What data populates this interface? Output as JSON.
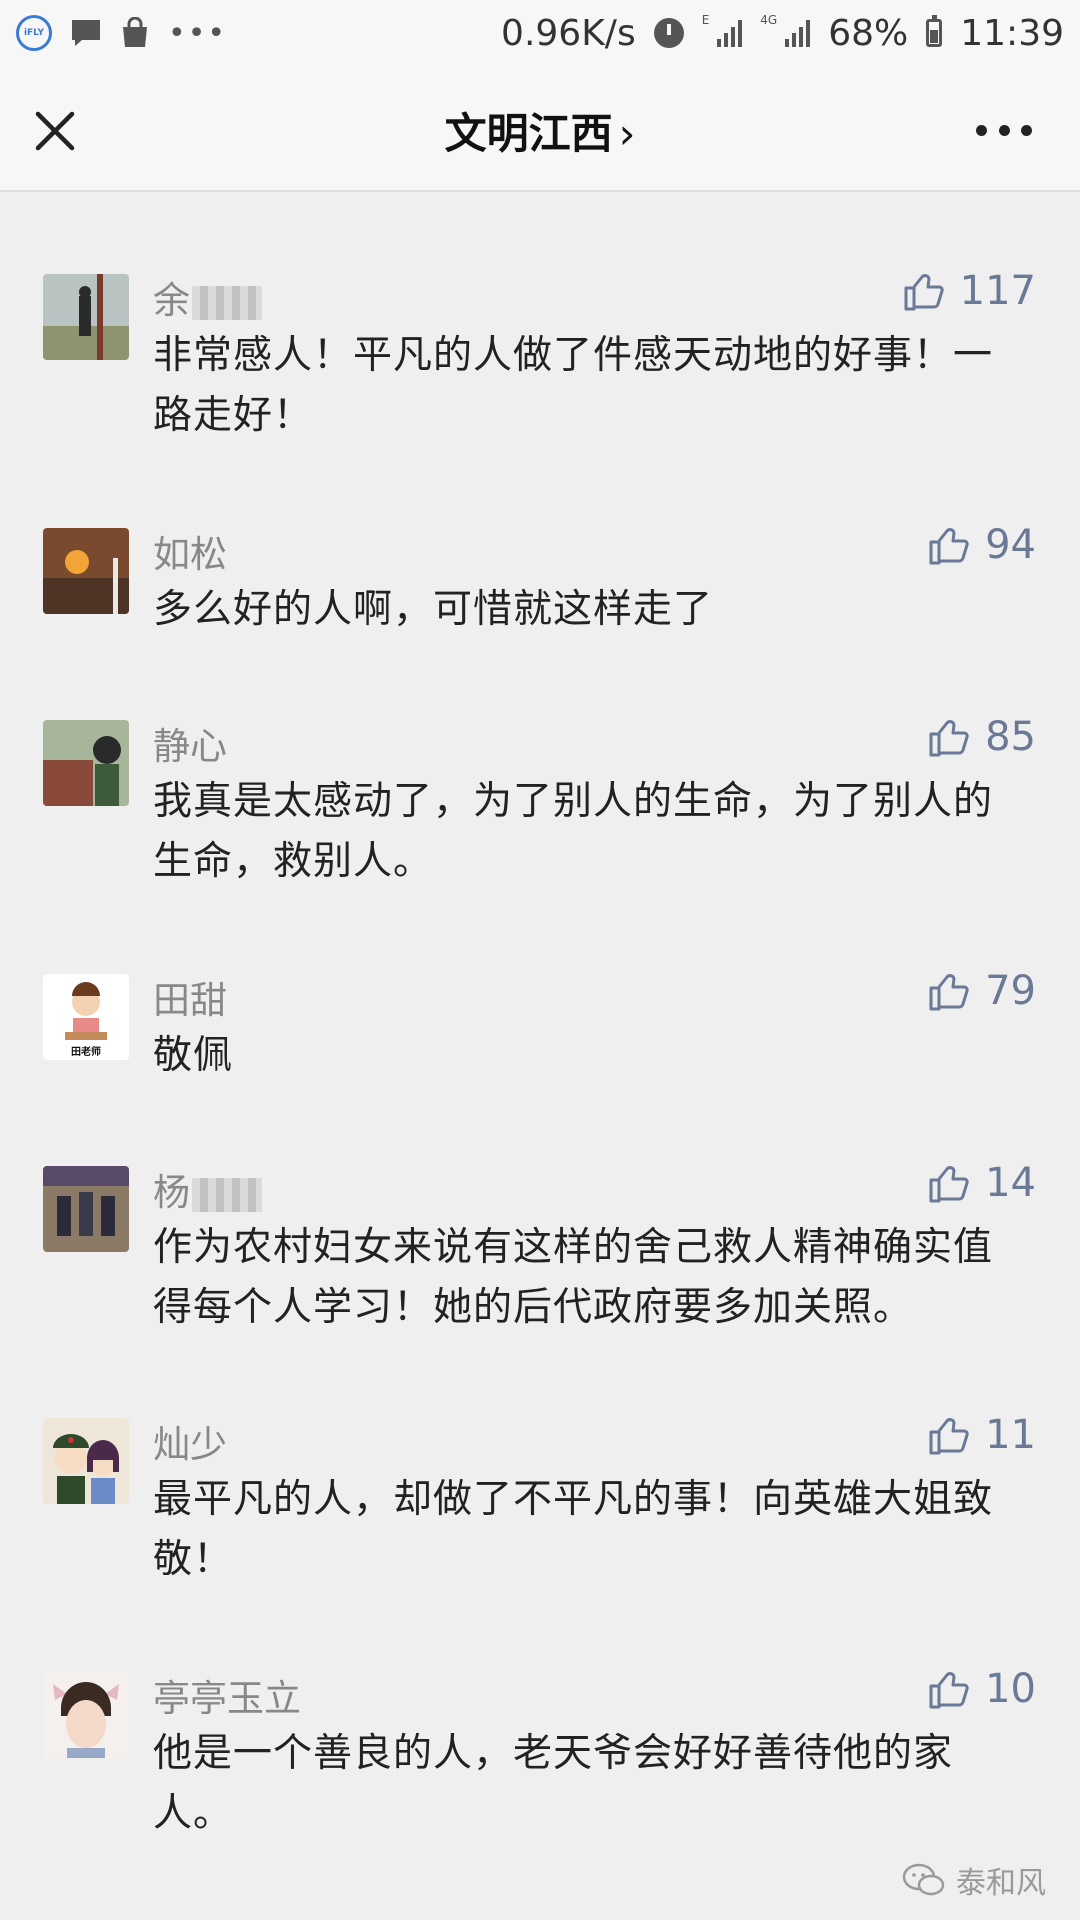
{
  "status": {
    "speed": "0.96K/s",
    "battery": "68%",
    "time": "11:39",
    "signal1_tag": "E",
    "signal2_tag": "4G"
  },
  "nav": {
    "title": "文明江西",
    "chevron": "›"
  },
  "comments": [
    {
      "name": "余",
      "likes": "117",
      "text": "非常感人！平凡的人做了件感天动地的好事！一路走好！",
      "avatar_color": "#8a9aa0"
    },
    {
      "name": "如松",
      "likes": "94",
      "text": "多么好的人啊，可惜就这样走了",
      "avatar_color": "#c26a2a"
    },
    {
      "name": "静心",
      "likes": "85",
      "text": "我真是太感动了，为了别人的生命，为了别人的生命，救别人。",
      "avatar_color": "#5c7a58"
    },
    {
      "name": "田甜",
      "likes": "79",
      "text": "敬佩",
      "avatar_label": "田老师",
      "avatar_color": "#ffffff"
    },
    {
      "name": "杨",
      "likes": "14",
      "text": "作为农村妇女来说有这样的舍己救人精神确实值得每个人学习！她的后代政府要多加关照。",
      "avatar_color": "#6b6f7a"
    },
    {
      "name": "灿少",
      "likes": "11",
      "text": "最平凡的人，却做了不平凡的事！向英雄大姐致敬！",
      "avatar_color": "#e8e0d0"
    },
    {
      "name": "亭亭玉立",
      "likes": "10",
      "text": "他是一个善良的人，老天爷会好好善待他的家人。",
      "avatar_color": "#f2e2dc"
    }
  ],
  "watermark": "泰和风"
}
